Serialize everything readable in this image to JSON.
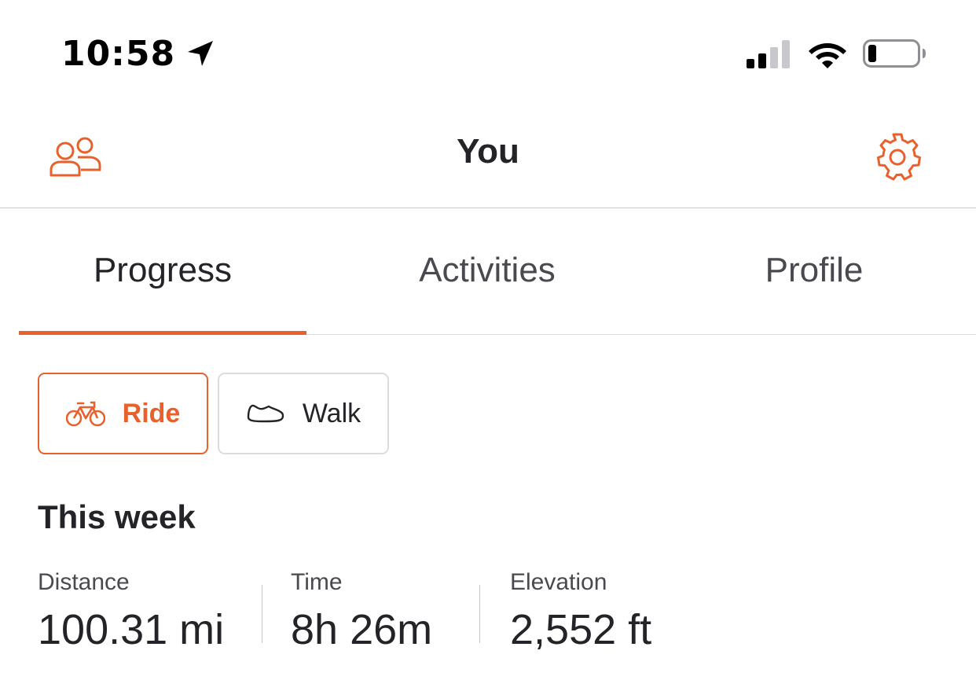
{
  "status_bar": {
    "time": "10:58",
    "location_icon": "location-arrow-icon",
    "signal_icon": "cellular-signal-icon",
    "wifi_icon": "wifi-icon",
    "battery_icon": "battery-low-icon",
    "signal_bars_filled": 2,
    "signal_bars_total": 4,
    "battery_level": 0.15
  },
  "nav": {
    "title": "You",
    "left_icon": "friends-icon",
    "right_icon": "gear-icon"
  },
  "tabs": [
    {
      "label": "Progress",
      "active": true
    },
    {
      "label": "Activities",
      "active": false
    },
    {
      "label": "Profile",
      "active": false
    }
  ],
  "sport_chips": [
    {
      "label": "Ride",
      "icon": "bicycle-icon",
      "active": true
    },
    {
      "label": "Walk",
      "icon": "shoe-icon",
      "active": false
    }
  ],
  "this_week": {
    "title": "This week",
    "stats": [
      {
        "label": "Distance",
        "value": "100.31 mi"
      },
      {
        "label": "Time",
        "value": "8h 26m"
      },
      {
        "label": "Elevation",
        "value": "2,552 ft"
      }
    ]
  },
  "colors": {
    "accent": "#e8612c",
    "text_primary": "#242428",
    "text_secondary": "#494950",
    "divider": "#c8c8cc",
    "chip_border": "#dcdce0"
  }
}
